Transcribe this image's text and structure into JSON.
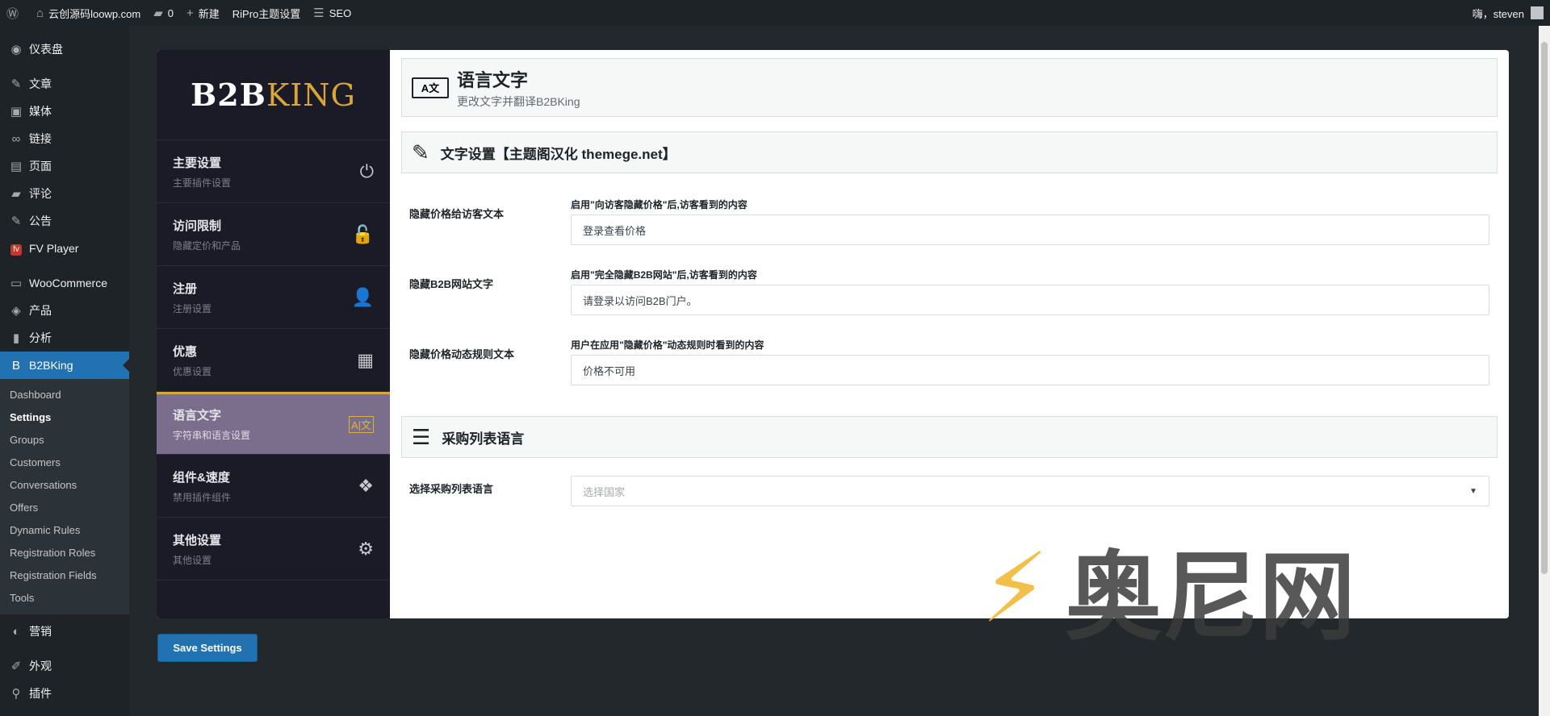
{
  "adminbar": {
    "site_name": "云创源码loowp.com",
    "comments_count": "0",
    "new_label": "新建",
    "theme_settings": "RiPro主题设置",
    "seo": "SEO",
    "greeting": "嗨，steven"
  },
  "menu": {
    "items": [
      {
        "label": "仪表盘",
        "icon": "dashboard-icon"
      },
      {
        "label": "文章",
        "icon": "pin-icon"
      },
      {
        "label": "媒体",
        "icon": "media-icon"
      },
      {
        "label": "链接",
        "icon": "link-icon"
      },
      {
        "label": "页面",
        "icon": "page-icon"
      },
      {
        "label": "评论",
        "icon": "comment-icon"
      },
      {
        "label": "公告",
        "icon": "pin-icon"
      },
      {
        "label": "FV Player",
        "icon": "fv-icon"
      },
      {
        "label": "WooCommerce",
        "icon": "woo-icon"
      },
      {
        "label": "产品",
        "icon": "box-icon"
      },
      {
        "label": "分析",
        "icon": "chart-icon"
      },
      {
        "label": "B2BKing",
        "icon": "b2bking-icon"
      }
    ],
    "sub_items": [
      "Dashboard",
      "Settings",
      "Groups",
      "Customers",
      "Conversations",
      "Offers",
      "Dynamic Rules",
      "Registration Roles",
      "Registration Fields",
      "Tools"
    ],
    "after_items": [
      {
        "label": "营销",
        "icon": "megaphone-icon"
      },
      {
        "label": "外观",
        "icon": "brush-icon"
      },
      {
        "label": "插件",
        "icon": "plugin-icon"
      }
    ]
  },
  "b2b_nav": {
    "logo_part1": "B2B",
    "logo_part2": "KING",
    "items": [
      {
        "title": "主要设置",
        "sub": "主要插件设置"
      },
      {
        "title": "访问限制",
        "sub": "隐藏定价和产品"
      },
      {
        "title": "注册",
        "sub": "注册设置"
      },
      {
        "title": "优惠",
        "sub": "优惠设置"
      },
      {
        "title": "语言文字",
        "sub": "字符串和语言设置"
      },
      {
        "title": "组件&速度",
        "sub": "禁用插件组件"
      },
      {
        "title": "其他设置",
        "sub": "其他设置"
      }
    ]
  },
  "content": {
    "header_icon": "A文",
    "header_title": "语言文字",
    "header_subtitle": "更改文字并翻译B2BKing",
    "section1_title": "文字设置【主题阁汉化 themege.net】",
    "fields": [
      {
        "label": "隐藏价格给访客文本",
        "desc": "启用\"向访客隐藏价格\"后,访客看到的内容",
        "value": "登录查看价格"
      },
      {
        "label": "隐藏B2B网站文字",
        "desc": "启用\"完全隐藏B2B网站\"后,访客看到的内容",
        "value": "请登录以访问B2B门户。"
      },
      {
        "label": "隐藏价格动态规则文本",
        "desc": "用户在应用\"隐藏价格\"动态规则时看到的内容",
        "value": "价格不可用"
      }
    ],
    "section2_title": "采购列表语言",
    "purchase_lang_label": "选择采购列表语言",
    "purchase_lang_placeholder": "选择国家"
  },
  "save_label": "Save Settings",
  "watermark": "奥尼网"
}
